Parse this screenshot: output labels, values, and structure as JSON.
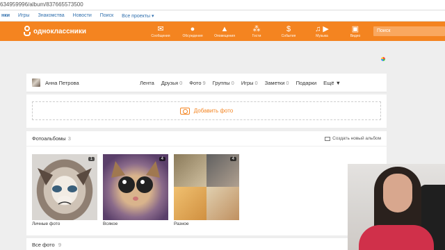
{
  "browser": {
    "url": "634959996/album/837665573500"
  },
  "topstrip": {
    "items": [
      "нки",
      "Игры",
      "Знакомства",
      "Новости",
      "Поиск",
      "Все проекты ▾"
    ]
  },
  "header": {
    "logo": "одноклассники",
    "nav": [
      {
        "label": "Сообщения",
        "icon": "envelope-icon",
        "glyph": "✉"
      },
      {
        "label": "Обсуждения",
        "icon": "chat-icon",
        "glyph": "●"
      },
      {
        "label": "Оповещения",
        "icon": "bell-icon",
        "glyph": "♫"
      },
      {
        "label": "Гости",
        "icon": "footprints-icon",
        "glyph": "⁂"
      },
      {
        "label": "События",
        "icon": "events-icon",
        "glyph": "$"
      },
      {
        "label": "Музыка",
        "icon": "music-icon",
        "glyph": "♫"
      },
      {
        "label": "Видео",
        "icon": "video-camera-icon",
        "glyph": "▣"
      }
    ],
    "search_placeholder": "Поиск"
  },
  "profile": {
    "name": "Анна Петрова",
    "tabs": [
      {
        "label": "Лента",
        "count": ""
      },
      {
        "label": "Друзья",
        "count": "0"
      },
      {
        "label": "Фото",
        "count": "9"
      },
      {
        "label": "Группы",
        "count": "0"
      },
      {
        "label": "Игры",
        "count": "0"
      },
      {
        "label": "Заметки",
        "count": "0"
      },
      {
        "label": "Подарки",
        "count": ""
      },
      {
        "label": "Ещё ▼",
        "count": ""
      }
    ]
  },
  "upload": {
    "label": "Добавить фото"
  },
  "albums": {
    "title": "Фотоальбомы",
    "count": "3",
    "create_label": "Создать новый альбом",
    "items": [
      {
        "caption": "Личные фото",
        "badge": "1"
      },
      {
        "caption": "Всякое",
        "badge": "4"
      },
      {
        "caption": "Разное",
        "badge": "4"
      }
    ]
  },
  "all_photos": {
    "title": "Все фото",
    "count": "9"
  },
  "colors": {
    "brand": "#f48420",
    "link": "#2f6fad"
  }
}
